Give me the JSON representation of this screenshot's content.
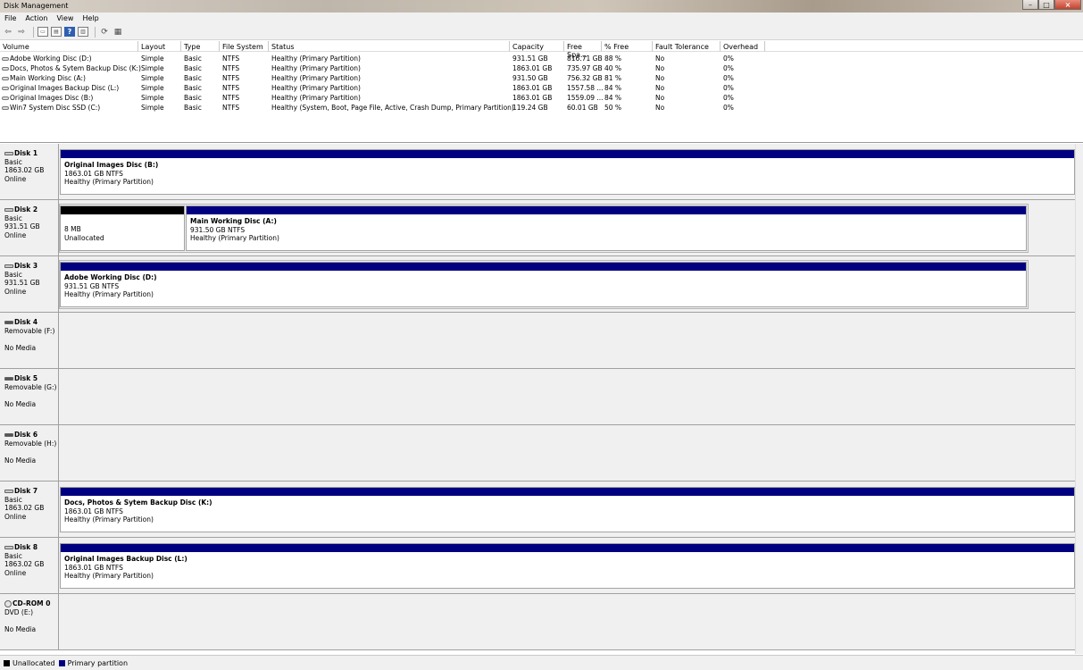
{
  "window": {
    "title": "Disk Management"
  },
  "menu": [
    "File",
    "Action",
    "View",
    "Help"
  ],
  "toolbar": [
    {
      "name": "back-icon",
      "glyph": "⇦"
    },
    {
      "name": "forward-icon",
      "glyph": "⇨"
    },
    {
      "name": "sep"
    },
    {
      "name": "console-tree-icon",
      "glyph": "▭"
    },
    {
      "name": "properties-icon",
      "glyph": "▤"
    },
    {
      "name": "help-icon",
      "glyph": "?"
    },
    {
      "name": "view-pane-icon",
      "glyph": "▥"
    },
    {
      "name": "sep"
    },
    {
      "name": "refresh-icon",
      "glyph": "⟳"
    },
    {
      "name": "rescan-disks-icon",
      "glyph": "▦"
    }
  ],
  "columns": [
    "Volume",
    "Layout",
    "Type",
    "File System",
    "Status",
    "Capacity",
    "Free Spa...",
    "% Free",
    "Fault Tolerance",
    "Overhead"
  ],
  "volumes": [
    [
      "Adobe Working Disc (D:)",
      "Simple",
      "Basic",
      "NTFS",
      "Healthy (Primary Partition)",
      "931.51 GB",
      "816.71 GB",
      "88 %",
      "No",
      "0%"
    ],
    [
      "Docs, Photos & Sytem Backup Disc (K:)",
      "Simple",
      "Basic",
      "NTFS",
      "Healthy (Primary Partition)",
      "1863.01 GB",
      "735.97 GB",
      "40 %",
      "No",
      "0%"
    ],
    [
      "Main Working Disc (A:)",
      "Simple",
      "Basic",
      "NTFS",
      "Healthy (Primary Partition)",
      "931.50 GB",
      "756.32 GB",
      "81 %",
      "No",
      "0%"
    ],
    [
      "Original Images Backup Disc (L:)",
      "Simple",
      "Basic",
      "NTFS",
      "Healthy (Primary Partition)",
      "1863.01 GB",
      "1557.58 ...",
      "84 %",
      "No",
      "0%"
    ],
    [
      "Original Images Disc (B:)",
      "Simple",
      "Basic",
      "NTFS",
      "Healthy (Primary Partition)",
      "1863.01 GB",
      "1559.09 ...",
      "84 %",
      "No",
      "0%"
    ],
    [
      "Win7 System Disc SSD (C:)",
      "Simple",
      "Basic",
      "NTFS",
      "Healthy (System, Boot, Page File, Active, Crash Dump, Primary Partition)",
      "119.24 GB",
      "60.01 GB",
      "50 %",
      "No",
      "0%"
    ]
  ],
  "disks": [
    {
      "label": "Disk 1",
      "kind": "fixed",
      "lines": [
        "Basic",
        "1863.02 GB",
        "Online"
      ],
      "partitions": [
        {
          "name": "Original Images Disc  (B:)",
          "size": "1863.01 GB NTFS",
          "status": "Healthy (Primary Partition)",
          "unalloc": false
        }
      ]
    },
    {
      "label": "Disk 2",
      "kind": "fixed",
      "lines": [
        "Basic",
        "931.51 GB",
        "Online"
      ],
      "partitions": [
        {
          "name": "",
          "size": "8 MB",
          "status": "Unallocated",
          "unalloc": true
        },
        {
          "name": "Main Working Disc  (A:)",
          "size": "931.50 GB NTFS",
          "status": "Healthy (Primary Partition)",
          "unalloc": false
        }
      ]
    },
    {
      "label": "Disk 3",
      "kind": "fixed",
      "lines": [
        "Basic",
        "931.51 GB",
        "Online"
      ],
      "partitions": [
        {
          "name": "Adobe Working Disc  (D:)",
          "size": "931.51 GB NTFS",
          "status": "Healthy (Primary Partition)",
          "unalloc": false
        }
      ]
    },
    {
      "label": "Disk 4",
      "kind": "removable",
      "lines": [
        "Removable (F:)",
        "",
        "No Media"
      ],
      "partitions": []
    },
    {
      "label": "Disk 5",
      "kind": "removable",
      "lines": [
        "Removable (G:)",
        "",
        "No Media"
      ],
      "partitions": []
    },
    {
      "label": "Disk 6",
      "kind": "removable",
      "lines": [
        "Removable (H:)",
        "",
        "No Media"
      ],
      "partitions": []
    },
    {
      "label": "Disk 7",
      "kind": "fixed",
      "lines": [
        "Basic",
        "1863.02 GB",
        "Online"
      ],
      "partitions": [
        {
          "name": "Docs, Photos & Sytem Backup Disc  (K:)",
          "size": "1863.01 GB NTFS",
          "status": "Healthy (Primary Partition)",
          "unalloc": false
        }
      ]
    },
    {
      "label": "Disk 8",
      "kind": "fixed",
      "lines": [
        "Basic",
        "1863.02 GB",
        "Online"
      ],
      "partitions": [
        {
          "name": "Original Images Backup Disc  (L:)",
          "size": "1863.01 GB NTFS",
          "status": "Healthy (Primary Partition)",
          "unalloc": false
        }
      ]
    },
    {
      "label": "CD-ROM 0",
      "kind": "cd",
      "lines": [
        "DVD (E:)",
        "",
        "No Media"
      ],
      "partitions": []
    }
  ],
  "legend": [
    {
      "label": "Unallocated",
      "color": "#000000"
    },
    {
      "label": "Primary partition",
      "color": "#000080"
    }
  ]
}
